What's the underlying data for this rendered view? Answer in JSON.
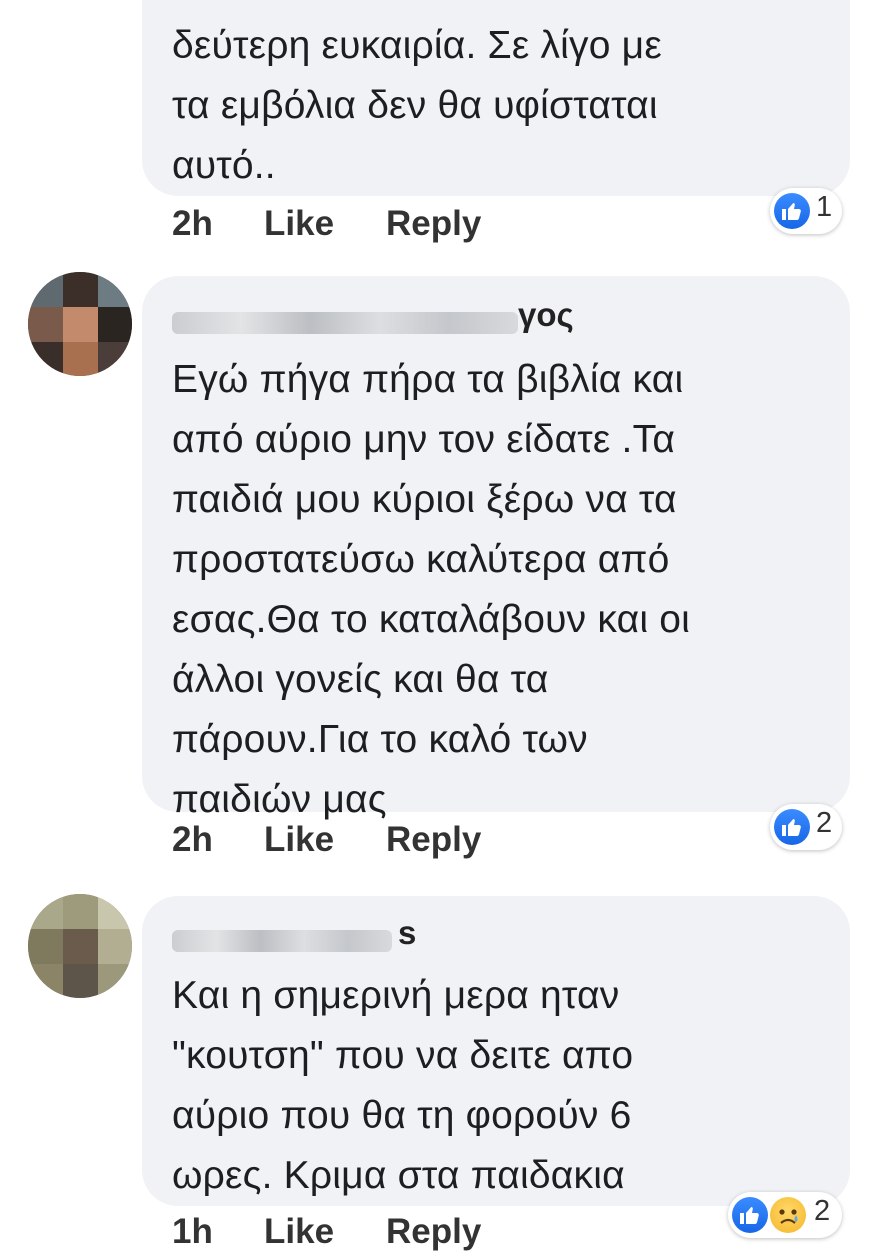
{
  "comments": [
    {
      "author_visible": "",
      "text": "δεύτερη ευκαιρία. Σε λίγο με\nτα εμβόλια δεν θα υφίσταται\nαυτό..",
      "time": "2h",
      "like_label": "Like",
      "reply_label": "Reply",
      "reaction_count": "1",
      "reactions": [
        "like-icon"
      ]
    },
    {
      "author_visible": "γος",
      "text": "Εγώ πήγα πήρα τα βιβλία και\nαπό αύριο μην τον είδατε .Τα\nπαιδιά μου κύριοι ξέρω να τα\nπροστατεύσω καλύτερα από\nεσας.Θα το καταλάβουν και οι\nάλλοι γονείς και θα τα\nπάρουν.Για το καλό των\nπαιδιών μας",
      "time": "2h",
      "like_label": "Like",
      "reply_label": "Reply",
      "reaction_count": "2",
      "reactions": [
        "like-icon"
      ]
    },
    {
      "author_visible": "s",
      "text": "Και η σημερινή μερα ηταν\n\"κουτση\" που να δειτε απο\nαύριο που θα τη φορούν 6\nωρες.  Κριμα στα παιδακια",
      "time": "1h",
      "like_label": "Like",
      "reply_label": "Reply",
      "reaction_count": "2",
      "reactions": [
        "like-icon",
        "sad-icon"
      ]
    }
  ],
  "colors": {
    "bubble": "#f0f2f5",
    "like_blue": "#1877f2",
    "text": "#1c1e21"
  }
}
